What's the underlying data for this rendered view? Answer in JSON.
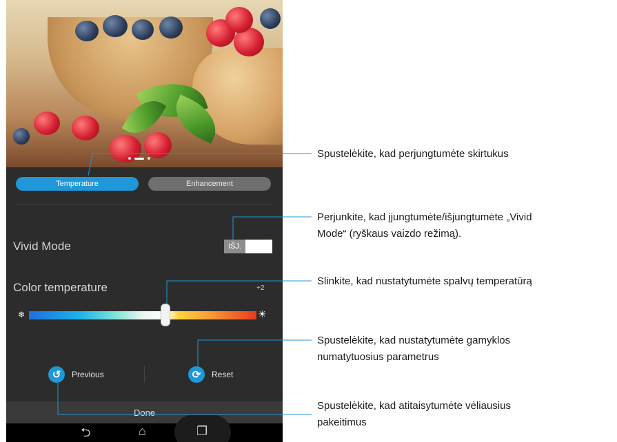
{
  "phone": {
    "tabs": [
      {
        "label": "Temperature",
        "active": true
      },
      {
        "label": "Enhancement",
        "active": false
      }
    ],
    "vivid_mode": {
      "label": "Vivid Mode",
      "toggle_text": "IŠJ.",
      "enabled": false
    },
    "color_temperature": {
      "label": "Color temperature",
      "value_text": "+2",
      "cold_icon": "snowflake-icon",
      "warm_icon": "sun-icon"
    },
    "actions": {
      "previous_label": "Previous",
      "reset_label": "Reset"
    },
    "done_label": "Done",
    "nav": {
      "back_icon": "back-icon",
      "home_icon": "home-icon",
      "recents_icon": "recent-apps-icon"
    }
  },
  "callouts": {
    "tabs": "Spustelėkite, kad perjungtumėte skirtukus",
    "vivid_line1": "Perjunkite, kad įjungtumėte/išjungtumėte „Vivid",
    "vivid_line2": "Mode“ (ryškaus vaizdo režimą).",
    "slider": "Slinkite, kad nustatytumėte spalvų temperatūrą",
    "reset_line1": "Spustelėkite, kad nustatytumėte gamyklos",
    "reset_line2": "numatytuosius parametrus",
    "previous_line1": "Spustelėkite, kad atitaisytumėte vėliausius",
    "previous_line2": "pakeitimus"
  },
  "colors": {
    "accent": "#1f97d8",
    "screen_bg": "#2c2c2c",
    "leader_line": "#1f97d8"
  }
}
